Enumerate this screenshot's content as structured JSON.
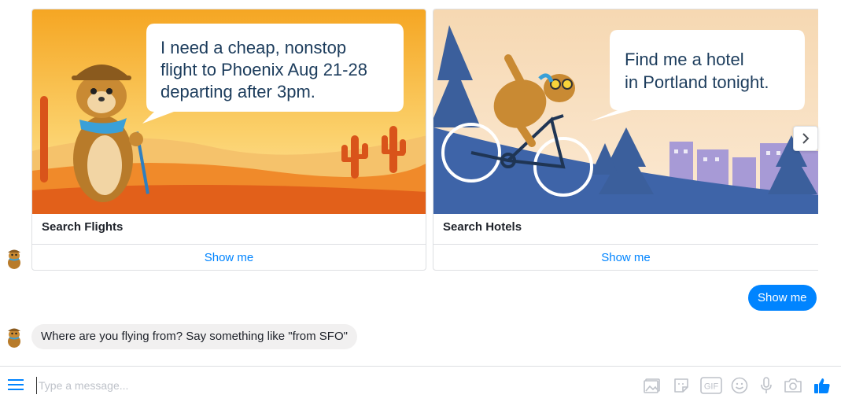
{
  "colors": {
    "accent": "#0084ff",
    "incoming_bubble": "#f1f0f0",
    "border": "#dddfe2",
    "icon_gray": "#bec2c9"
  },
  "bot": {
    "avatar_icon": "chipmunk-avatar-icon"
  },
  "carousel": {
    "cards": [
      {
        "title": "Search Flights",
        "button": "Show me",
        "image_speech": [
          "I need a cheap, nonstop",
          "flight to Phoenix Aug 21-28",
          "departing after 3pm."
        ]
      },
      {
        "title": "Search Hotels",
        "button": "Show me",
        "image_speech": [
          "Find me a hotel",
          "in Portland tonight."
        ]
      }
    ],
    "next_icon": "chevron-right-icon"
  },
  "messages": {
    "user_reply": "Show me",
    "bot_question": "Where are you flying from? Say something like \"from SFO\""
  },
  "composer": {
    "placeholder": "Type a message...",
    "icons": [
      "menu-icon",
      "image-icon",
      "sticker-icon",
      "gif-icon",
      "emoji-icon",
      "microphone-icon",
      "camera-icon",
      "thumbs-up-icon"
    ]
  }
}
